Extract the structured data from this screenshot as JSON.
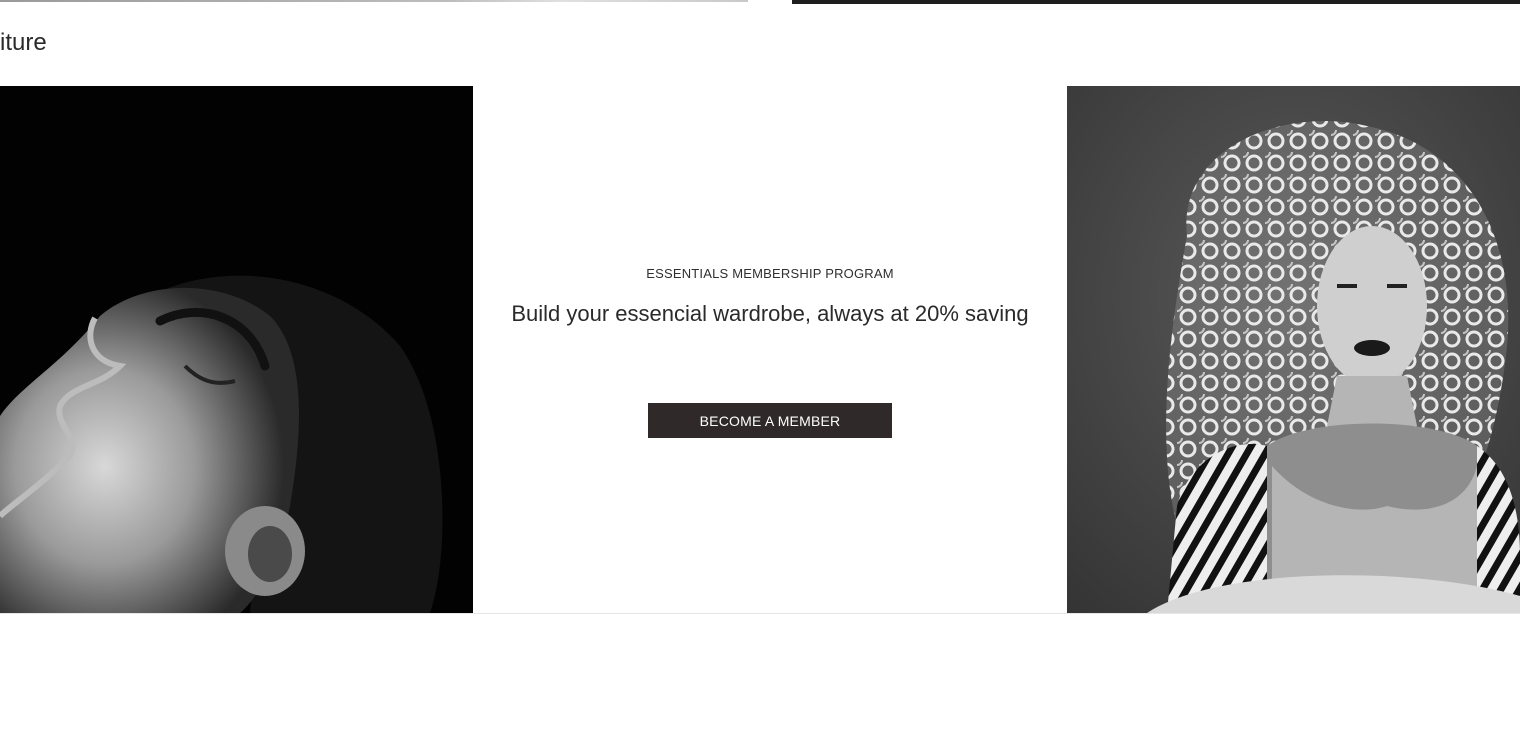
{
  "section": {
    "heading": "iture"
  },
  "promo": {
    "eyebrow": "ESSENTIALS MEMBERSHIP PROGRAM",
    "title": "Build your essencial wardrobe, always at 20% saving",
    "cta_label": "BECOME A MEMBER"
  },
  "images": {
    "left": "woman-profile-photo",
    "right": "curly-hair-model-photo"
  },
  "colors": {
    "button_bg": "#2f2a29",
    "button_text": "#ffffff",
    "text": "#2a2a2a"
  }
}
